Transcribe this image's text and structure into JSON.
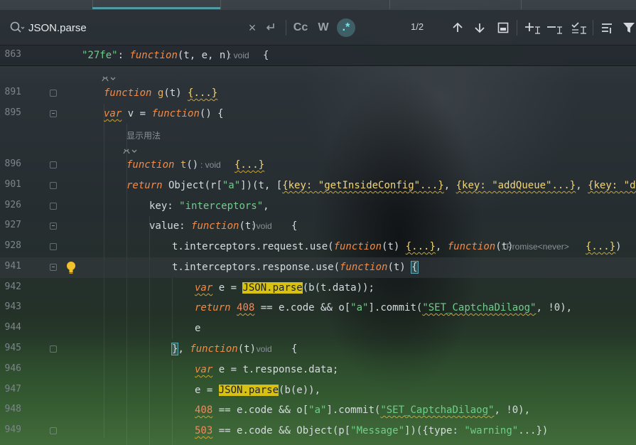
{
  "tabs": {
    "active_index": 0
  },
  "search": {
    "query": "JSON.parse",
    "placeholder": "",
    "match_case_label": "Cc",
    "whole_word_label": "W",
    "regex_label": ".*",
    "match_count": "1/2",
    "close_glyph": "×"
  },
  "colors": {
    "keyword": "#f08c4a",
    "function_name": "#e5b05c",
    "string": "#6fce8a",
    "number": "#f3885d",
    "search_highlight": "#d7c213",
    "active_toggle": "#7fe0ee"
  },
  "editor": {
    "lines": [
      {
        "num": "863",
        "tokens": [
          [
            "str",
            "\"27fe\""
          ],
          [
            "pl",
            ": "
          ],
          [
            "kw",
            "function"
          ],
          [
            "pl",
            "(t, e, n)"
          ]
        ],
        "hint": ": void",
        "after_hint": [
          [
            "pl",
            "{"
          ]
        ]
      },
      {
        "num": "891",
        "tokens": [
          [
            "kw",
            "function"
          ],
          [
            "pl",
            " "
          ],
          [
            "fn",
            "g"
          ],
          [
            "pl",
            "(t) "
          ],
          [
            "fold",
            "{...}"
          ]
        ]
      },
      {
        "num": "895",
        "tokens": [
          [
            "kw",
            "var"
          ],
          [
            "pl",
            " v = "
          ],
          [
            "kw",
            "function"
          ],
          [
            "pl",
            "() {"
          ]
        ]
      },
      {
        "num": "896",
        "tokens": [
          [
            "kw",
            "function"
          ],
          [
            "pl",
            " "
          ],
          [
            "fn",
            "t"
          ],
          [
            "pl",
            "()"
          ]
        ],
        "hint": ": void",
        "after_hint": [
          [
            "fold",
            "{...}"
          ]
        ]
      },
      {
        "num": "901",
        "tokens": [
          [
            "kw",
            "return"
          ],
          [
            "pl",
            " Object(r["
          ],
          [
            "str",
            "\"a\""
          ],
          [
            "pl",
            "])(t, ["
          ],
          [
            "fold",
            "{key: \"getInsideConfig\"...}"
          ],
          [
            "pl",
            ", "
          ],
          [
            "fold",
            "{key: \"addQueue\"...}"
          ],
          [
            "pl",
            ", "
          ],
          [
            "fold",
            "{key: \"delQue"
          ]
        ]
      },
      {
        "num": "926",
        "tokens": [
          [
            "pl",
            "key: "
          ],
          [
            "str",
            "\"interceptors\""
          ],
          [
            "pl",
            ","
          ]
        ]
      },
      {
        "num": "927",
        "tokens": [
          [
            "pl",
            "value: "
          ],
          [
            "kw",
            "function"
          ],
          [
            "pl",
            "(t)"
          ]
        ],
        "hint": ": void",
        "after_hint": [
          [
            "pl",
            "{"
          ]
        ]
      },
      {
        "num": "928",
        "tokens": [
          [
            "pl",
            "t.interceptors.request.use("
          ],
          [
            "kw",
            "function"
          ],
          [
            "pl",
            "(t) "
          ],
          [
            "fold",
            "{...}"
          ],
          [
            "pl",
            ", "
          ],
          [
            "kw",
            "function"
          ],
          [
            "pl",
            "(t)"
          ]
        ],
        "hint": ": Promise<never>",
        "after_hint": [
          [
            "fold",
            "{...}"
          ],
          [
            "pl",
            ")"
          ]
        ]
      },
      {
        "num": "941",
        "tokens": [
          [
            "pl",
            "t.interceptors.response.use("
          ],
          [
            "kw",
            "function"
          ],
          [
            "pl",
            "(t) "
          ],
          [
            "caret",
            "{"
          ]
        ]
      },
      {
        "num": "942",
        "tokens": [
          [
            "kw",
            "var"
          ],
          [
            "pl",
            " e = "
          ],
          [
            "hl",
            "JSON.parse"
          ],
          [
            "pl",
            "(b(t.data));"
          ]
        ]
      },
      {
        "num": "943",
        "tokens": [
          [
            "kw",
            "return"
          ],
          [
            "pl",
            " "
          ],
          [
            "num",
            "408"
          ],
          [
            "pl",
            " == e.code && o["
          ],
          [
            "str",
            "\"a\""
          ],
          [
            "pl",
            "].commit("
          ],
          [
            "str",
            "\"SET_CaptchaDilaog\""
          ],
          [
            "pl",
            ", !0),"
          ]
        ]
      },
      {
        "num": "944",
        "tokens": [
          [
            "pl",
            "e"
          ]
        ]
      },
      {
        "num": "945",
        "tokens": [
          [
            "caret",
            "}"
          ],
          [
            "pl",
            ", "
          ],
          [
            "kw",
            "function"
          ],
          [
            "pl",
            "(t)"
          ]
        ],
        "hint": ": void",
        "after_hint": [
          [
            "pl",
            "{"
          ]
        ]
      },
      {
        "num": "946",
        "tokens": [
          [
            "kw",
            "var"
          ],
          [
            "pl",
            " e = t.response.data;"
          ]
        ]
      },
      {
        "num": "947",
        "tokens": [
          [
            "pl",
            "e = "
          ],
          [
            "hl",
            "JSON.parse"
          ],
          [
            "pl",
            "(b(e)),"
          ]
        ]
      },
      {
        "num": "948",
        "tokens": [
          [
            "num",
            "408"
          ],
          [
            "pl",
            " == e.code && o["
          ],
          [
            "str",
            "\"a\""
          ],
          [
            "pl",
            "].commit("
          ],
          [
            "str",
            "\"SET_CaptchaDilaog\""
          ],
          [
            "pl",
            ", !0),"
          ]
        ]
      },
      {
        "num": "949",
        "tokens": [
          [
            "num",
            "503"
          ],
          [
            "pl",
            " == e.code && Object(p["
          ],
          [
            "str",
            "\"Message\""
          ],
          [
            "pl",
            "])({type: "
          ],
          [
            "str",
            "\"warning\""
          ],
          [
            "pl",
            "...})"
          ]
        ]
      }
    ],
    "inlay_hints": {
      "show_usage": "显示用法"
    }
  }
}
